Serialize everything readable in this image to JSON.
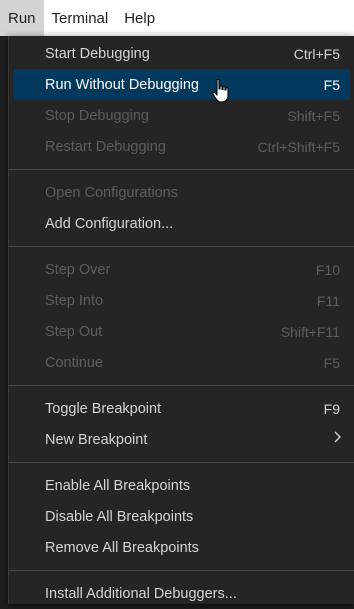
{
  "menubar": {
    "items": [
      {
        "label": "Run"
      },
      {
        "label": "Terminal"
      },
      {
        "label": "Help"
      }
    ]
  },
  "menu": {
    "start_debugging": {
      "label": "Start Debugging",
      "shortcut": "Ctrl+F5"
    },
    "run_without_debugging": {
      "label": "Run Without Debugging",
      "shortcut": "F5"
    },
    "stop_debugging": {
      "label": "Stop Debugging",
      "shortcut": "Shift+F5"
    },
    "restart_debugging": {
      "label": "Restart Debugging",
      "shortcut": "Ctrl+Shift+F5"
    },
    "open_configurations": {
      "label": "Open Configurations"
    },
    "add_configuration": {
      "label": "Add Configuration..."
    },
    "step_over": {
      "label": "Step Over",
      "shortcut": "F10"
    },
    "step_into": {
      "label": "Step Into",
      "shortcut": "F11"
    },
    "step_out": {
      "label": "Step Out",
      "shortcut": "Shift+F11"
    },
    "continue": {
      "label": "Continue",
      "shortcut": "F5"
    },
    "toggle_breakpoint": {
      "label": "Toggle Breakpoint",
      "shortcut": "F9"
    },
    "new_breakpoint": {
      "label": "New Breakpoint",
      "icon": "chevron-right-icon"
    },
    "enable_all_breakpoints": {
      "label": "Enable All Breakpoints"
    },
    "disable_all_breakpoints": {
      "label": "Disable All Breakpoints"
    },
    "remove_all_breakpoints": {
      "label": "Remove All Breakpoints"
    },
    "install_additional_debuggers": {
      "label": "Install Additional Debuggers..."
    }
  },
  "colors": {
    "menu_background": "#252526",
    "highlight": "#04395e",
    "disabled_text": "#5d5d5d",
    "text": "#d4d4d4"
  }
}
